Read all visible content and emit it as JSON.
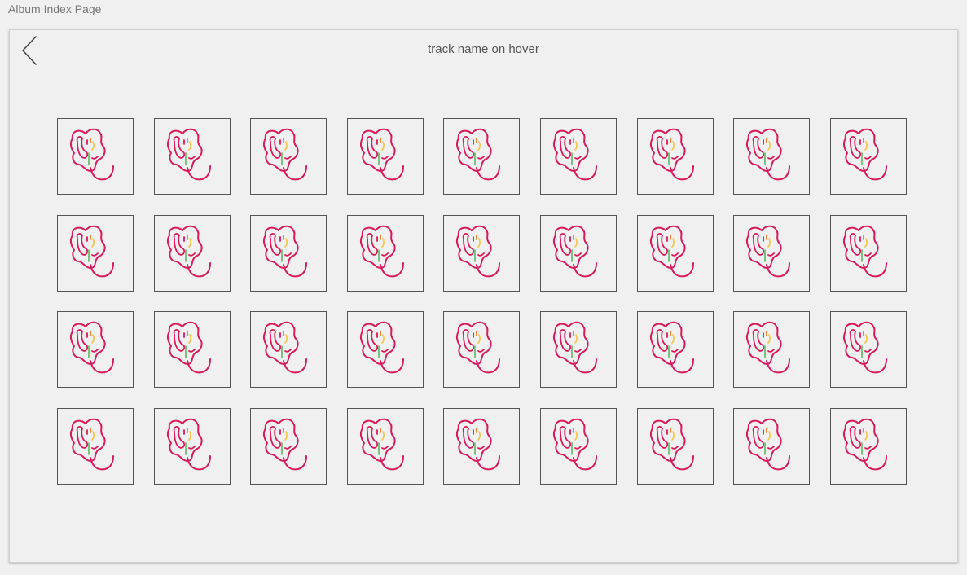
{
  "page": {
    "label": "Album Index Page"
  },
  "header": {
    "title": "track name on hover",
    "back_icon": "chevron-left-icon"
  },
  "grid": {
    "rows": 4,
    "columns": 9,
    "tile_icon": "album-cover-doodle-icon",
    "colors": {
      "tile_border": "#555555",
      "doodle_main": "#d81b5c",
      "doodle_yellow": "#f5c542",
      "doodle_orange": "#f07a2a",
      "doodle_green": "#5cb85c"
    }
  }
}
